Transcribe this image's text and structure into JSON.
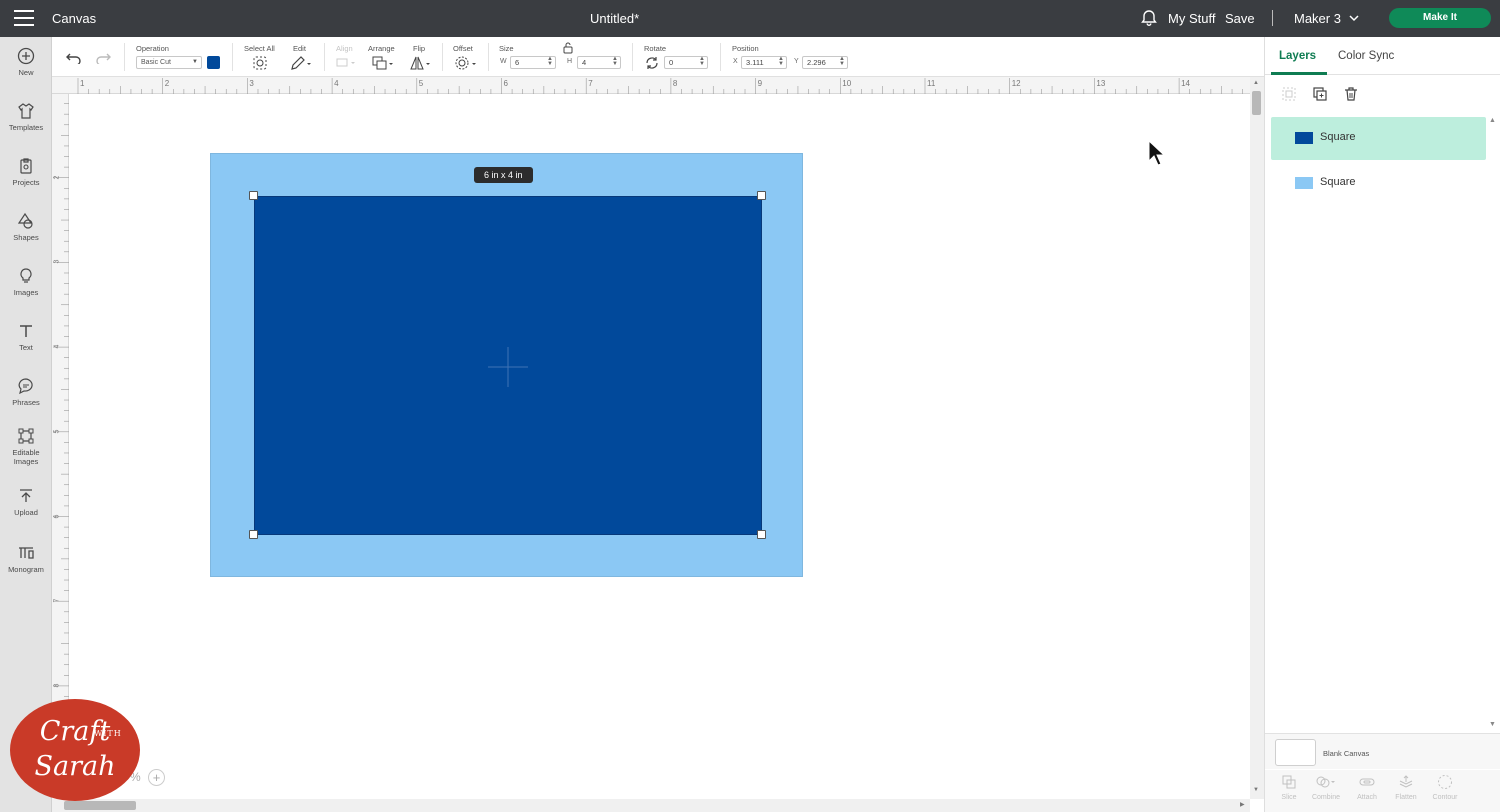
{
  "topbar": {
    "app_title": "Canvas",
    "doc_title": "Untitled*",
    "my_stuff": "My Stuff",
    "save": "Save",
    "machine": "Maker 3",
    "make_it": "Make It"
  },
  "sidebar": {
    "items": [
      {
        "label": "New",
        "icon": "plus-circle-icon"
      },
      {
        "label": "Templates",
        "icon": "shirt-icon"
      },
      {
        "label": "Projects",
        "icon": "projects-icon"
      },
      {
        "label": "Shapes",
        "icon": "shapes-icon"
      },
      {
        "label": "Images",
        "icon": "lightbulb-icon"
      },
      {
        "label": "Text",
        "icon": "text-icon"
      },
      {
        "label": "Phrases",
        "icon": "speech-bubble-icon"
      },
      {
        "label": "Editable Images",
        "icon": "editable-images-icon"
      },
      {
        "label": "Upload",
        "icon": "upload-icon"
      },
      {
        "label": "Monogram",
        "icon": "monogram-icon"
      }
    ]
  },
  "toolbar": {
    "operation_label": "Operation",
    "operation_value": "Basic Cut",
    "operation_color": "#01499b",
    "select_all_label": "Select All",
    "edit_label": "Edit",
    "align_label": "Align",
    "arrange_label": "Arrange",
    "flip_label": "Flip",
    "offset_label": "Offset",
    "size_label": "Size",
    "width_axis": "W",
    "width_value": "6",
    "height_axis": "H",
    "height_value": "4",
    "rotate_label": "Rotate",
    "rotate_value": "0",
    "position_label": "Position",
    "x_axis": "X",
    "x_value": "3.111",
    "y_axis": "Y",
    "y_value": "2.296"
  },
  "ruler": {
    "top": [
      "1",
      "2",
      "3",
      "4",
      "5",
      "6",
      "7",
      "8",
      "9",
      "10",
      "11",
      "12",
      "13",
      "14"
    ],
    "left": [
      "1",
      "2",
      "3",
      "4",
      "5",
      "6",
      "7",
      "8"
    ]
  },
  "canvas": {
    "size_tooltip": "6  in x 4  in",
    "outer_shape_color": "#8bc8f4",
    "inner_shape_color": "#01499b"
  },
  "zoom": {
    "percent_symbol": "%",
    "plus": "+"
  },
  "logo": {
    "line1": "Craft",
    "with": "WITH",
    "line2": "Sarah"
  },
  "right_panel": {
    "tabs": [
      "Layers",
      "Color Sync"
    ],
    "layers": [
      {
        "name": "Square",
        "color": "#01499b",
        "selected": true
      },
      {
        "name": "Square",
        "color": "#8bc8f4",
        "selected": false
      }
    ],
    "blank_canvas": "Blank Canvas",
    "actions": [
      "Slice",
      "Combine",
      "Attach",
      "Flatten",
      "Contour"
    ]
  }
}
